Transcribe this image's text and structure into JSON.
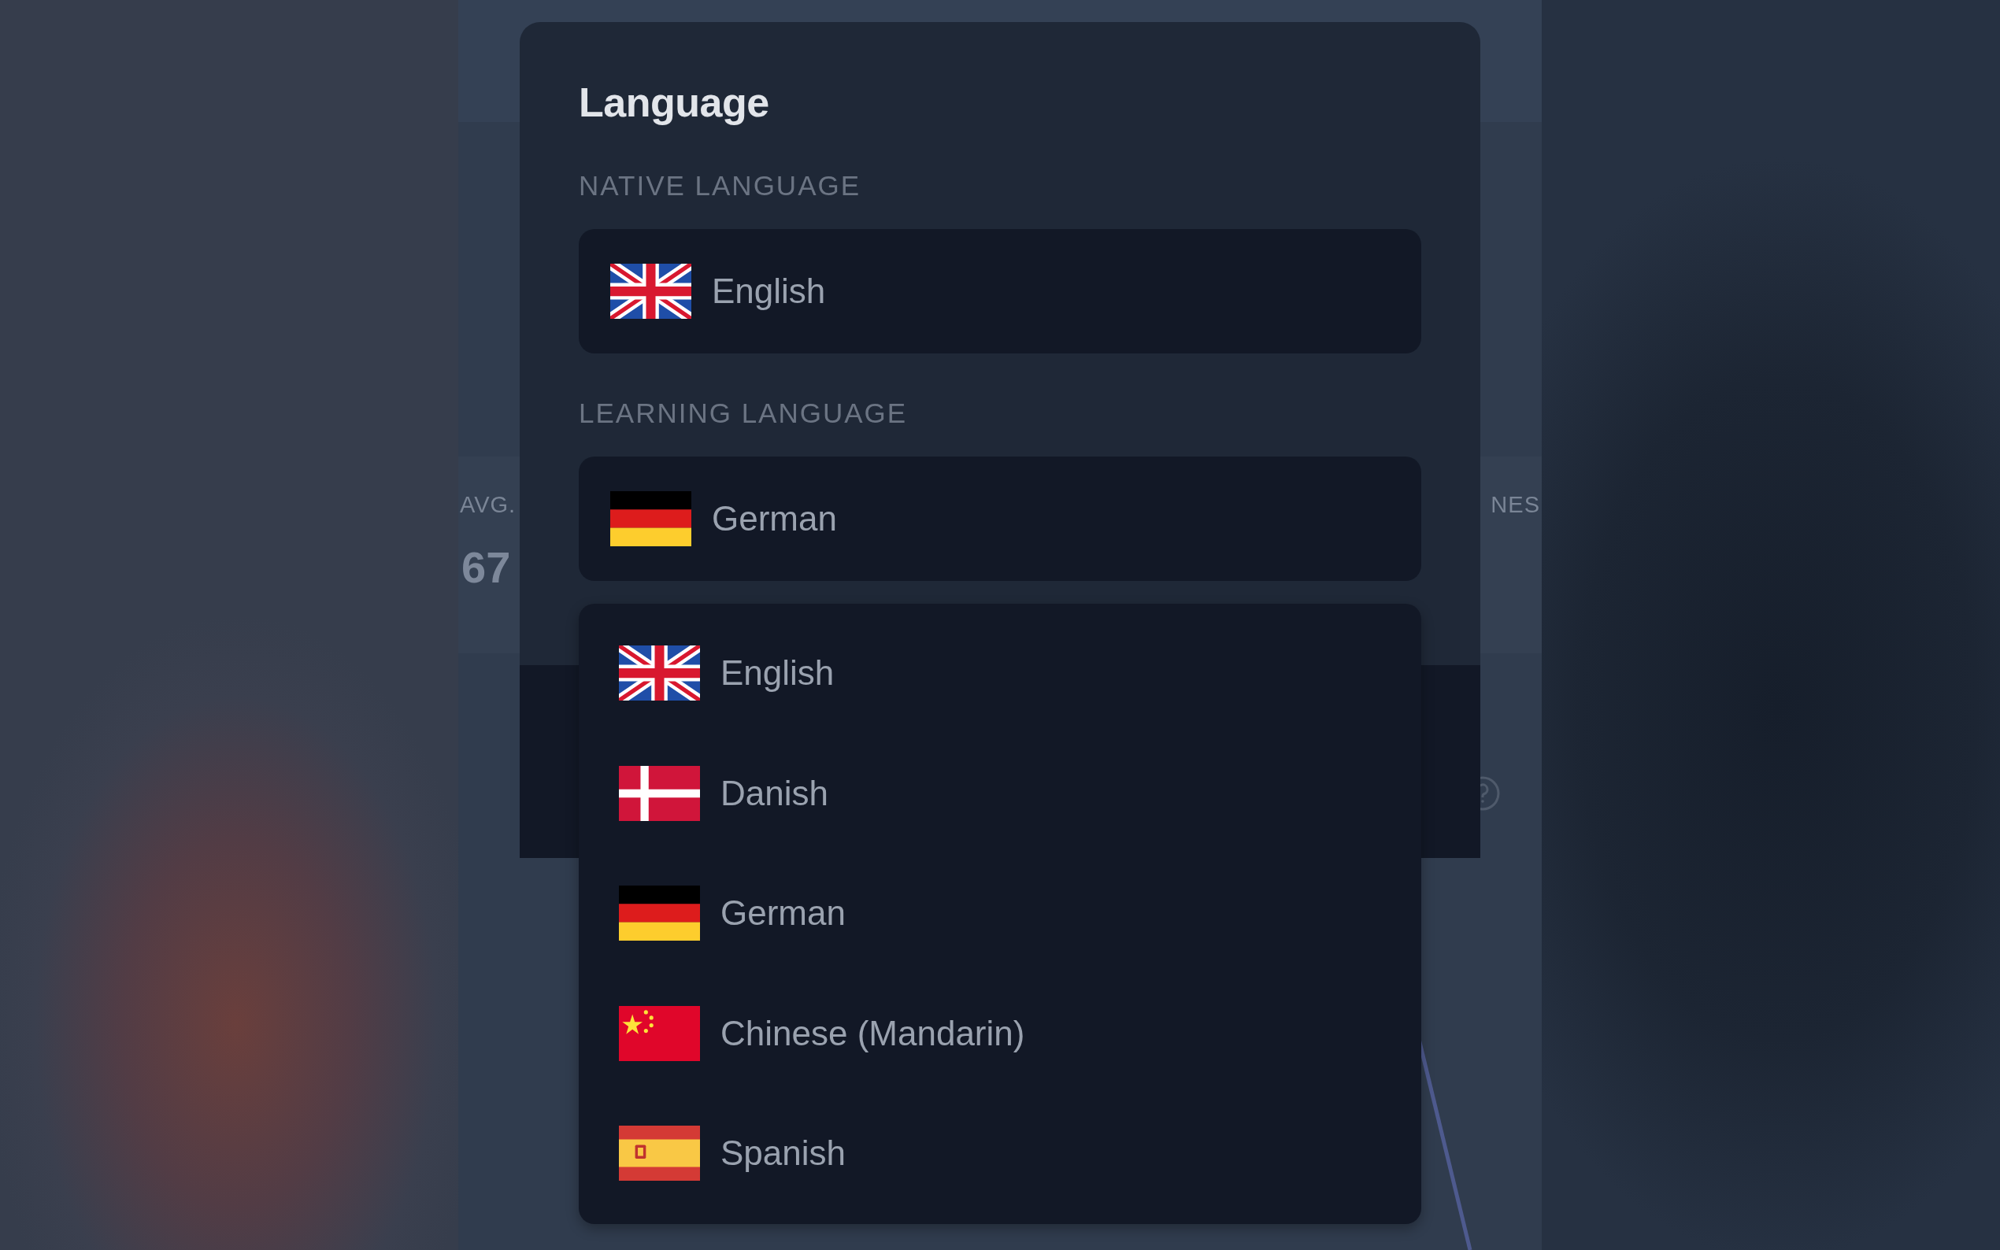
{
  "behind": {
    "stat_left": {
      "label": "AVG.",
      "value": "67"
    },
    "stat_right": {
      "label": "NES"
    }
  },
  "dialog": {
    "title": "Language",
    "native": {
      "label": "NATIVE LANGUAGE",
      "value": "English",
      "kind": "gb"
    },
    "learning": {
      "label": "LEARNING LANGUAGE",
      "value": "German",
      "kind": "de",
      "expanded": true
    },
    "options": [
      {
        "label": "English",
        "kind": "gb"
      },
      {
        "label": "Danish",
        "kind": "dk"
      },
      {
        "label": "German",
        "kind": "de"
      },
      {
        "label": "Chinese (Mandarin)",
        "kind": "cn"
      },
      {
        "label": "Spanish",
        "kind": "es"
      }
    ]
  }
}
